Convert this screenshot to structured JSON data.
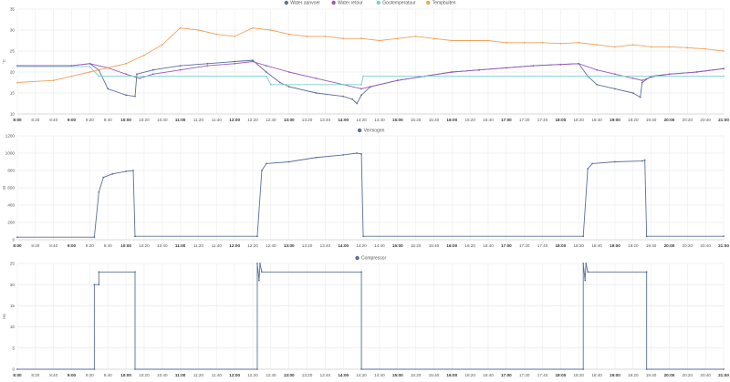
{
  "x_ticks": [
    "8:00",
    "8:20",
    "8:40",
    "9:00",
    "9:20",
    "9:40",
    "10:00",
    "10:20",
    "10:40",
    "11:00",
    "11:20",
    "11:40",
    "12:00",
    "12:20",
    "12:40",
    "13:00",
    "13:20",
    "13:40",
    "14:00",
    "14:20",
    "14:40",
    "15:00",
    "15:20",
    "15:40",
    "16:00",
    "16:20",
    "16:40",
    "17:00",
    "17:20",
    "17:40",
    "18:00",
    "18:20",
    "18:40",
    "19:00",
    "19:20",
    "19:40",
    "20:00",
    "20:20",
    "20:40",
    "21:00"
  ],
  "x_bold": [
    "8:00",
    "9:00",
    "10:00",
    "11:00",
    "12:00",
    "13:00",
    "14:00",
    "15:00",
    "16:00",
    "17:00",
    "18:00",
    "19:00",
    "20:00",
    "21:00"
  ],
  "chart_data": [
    {
      "type": "line",
      "ylabel": "°C",
      "ylim": [
        10,
        35
      ],
      "yticks": [
        10,
        15,
        20,
        25,
        30,
        35
      ],
      "grid": true,
      "legend": "top-center",
      "x_unit": "time (8:00–21:00)",
      "series": [
        {
          "name": "Water aanvoer",
          "color": "#5b6f9a",
          "marker": "filled",
          "points": [
            [
              "8:00",
              21.5
            ],
            [
              "9:00",
              21.5
            ],
            [
              "9:20",
              22.0
            ],
            [
              "9:30",
              20.5
            ],
            [
              "9:40",
              16.0
            ],
            [
              "10:00",
              14.5
            ],
            [
              "10:10",
              14.2
            ],
            [
              "10:12",
              19.5
            ],
            [
              "10:30",
              20.5
            ],
            [
              "11:00",
              21.5
            ],
            [
              "11:30",
              22.0
            ],
            [
              "12:00",
              22.5
            ],
            [
              "12:20",
              22.8
            ],
            [
              "12:35",
              20.0
            ],
            [
              "12:50",
              17.5
            ],
            [
              "13:00",
              16.5
            ],
            [
              "13:30",
              15.0
            ],
            [
              "14:00",
              14.2
            ],
            [
              "14:10",
              13.5
            ],
            [
              "14:15",
              12.5
            ],
            [
              "14:20",
              14.5
            ],
            [
              "14:30",
              16.5
            ],
            [
              "15:00",
              18.0
            ],
            [
              "15:30",
              19.0
            ],
            [
              "16:00",
              20.0
            ],
            [
              "16:30",
              20.5
            ],
            [
              "17:00",
              21.0
            ],
            [
              "17:30",
              21.5
            ],
            [
              "18:00",
              21.8
            ],
            [
              "18:20",
              22.0
            ],
            [
              "18:30",
              19.0
            ],
            [
              "18:40",
              17.0
            ],
            [
              "19:00",
              16.0
            ],
            [
              "19:20",
              15.0
            ],
            [
              "19:28",
              14.0
            ],
            [
              "19:30",
              17.5
            ],
            [
              "19:40",
              19.0
            ],
            [
              "20:00",
              19.5
            ],
            [
              "20:30",
              20.0
            ],
            [
              "21:00",
              20.8
            ]
          ]
        },
        {
          "name": "Water retour",
          "color": "#9b59b6",
          "marker": "filled",
          "points": [
            [
              "8:00",
              21.5
            ],
            [
              "9:00",
              21.5
            ],
            [
              "9:20",
              22.0
            ],
            [
              "9:40",
              21.0
            ],
            [
              "10:00",
              19.5
            ],
            [
              "10:15",
              18.5
            ],
            [
              "10:30",
              19.5
            ],
            [
              "11:00",
              20.5
            ],
            [
              "11:30",
              21.5
            ],
            [
              "12:00",
              22.0
            ],
            [
              "12:20",
              22.5
            ],
            [
              "12:35",
              21.5
            ],
            [
              "13:00",
              20.0
            ],
            [
              "13:30",
              18.5
            ],
            [
              "14:00",
              17.0
            ],
            [
              "14:20",
              16.0
            ],
            [
              "14:30",
              16.5
            ],
            [
              "15:00",
              18.0
            ],
            [
              "15:30",
              19.0
            ],
            [
              "16:00",
              20.0
            ],
            [
              "16:30",
              20.5
            ],
            [
              "17:00",
              21.0
            ],
            [
              "17:30",
              21.5
            ],
            [
              "18:00",
              21.8
            ],
            [
              "18:20",
              22.0
            ],
            [
              "18:40",
              20.5
            ],
            [
              "19:00",
              19.5
            ],
            [
              "19:20",
              18.5
            ],
            [
              "19:30",
              18.0
            ],
            [
              "19:40",
              18.8
            ],
            [
              "20:00",
              19.5
            ],
            [
              "20:30",
              20.0
            ],
            [
              "21:00",
              20.8
            ]
          ]
        },
        {
          "name": "Gootemperatuur",
          "color": "#7ecfd3",
          "marker": "filled",
          "points": [
            [
              "8:00",
              21.3
            ],
            [
              "9:20",
              21.3
            ],
            [
              "9:30",
              19.0
            ],
            [
              "12:35",
              19.0
            ],
            [
              "12:40",
              17.0
            ],
            [
              "14:00",
              17.0
            ],
            [
              "14:20",
              17.0
            ],
            [
              "14:22",
              19.0
            ],
            [
              "21:00",
              19.0
            ]
          ]
        },
        {
          "name": "Tempbuiten",
          "color": "#f0a35b",
          "marker": "filled",
          "points": [
            [
              "8:00",
              17.5
            ],
            [
              "8:40",
              18.0
            ],
            [
              "9:00",
              19.0
            ],
            [
              "9:20",
              20.0
            ],
            [
              "9:40",
              21.0
            ],
            [
              "10:00",
              22.0
            ],
            [
              "10:20",
              24.0
            ],
            [
              "10:40",
              26.5
            ],
            [
              "11:00",
              30.5
            ],
            [
              "11:20",
              30.0
            ],
            [
              "11:40",
              29.0
            ],
            [
              "12:00",
              28.5
            ],
            [
              "12:20",
              30.5
            ],
            [
              "12:40",
              30.0
            ],
            [
              "13:00",
              29.0
            ],
            [
              "13:20",
              28.5
            ],
            [
              "13:40",
              28.5
            ],
            [
              "14:00",
              28.0
            ],
            [
              "14:20",
              28.0
            ],
            [
              "14:40",
              27.5
            ],
            [
              "15:00",
              28.0
            ],
            [
              "15:20",
              28.5
            ],
            [
              "15:40",
              28.0
            ],
            [
              "16:00",
              27.5
            ],
            [
              "16:20",
              27.5
            ],
            [
              "16:40",
              27.5
            ],
            [
              "17:00",
              27.0
            ],
            [
              "17:20",
              27.0
            ],
            [
              "17:40",
              27.0
            ],
            [
              "18:00",
              26.8
            ],
            [
              "18:20",
              27.0
            ],
            [
              "18:40",
              26.5
            ],
            [
              "19:00",
              26.0
            ],
            [
              "19:20",
              26.5
            ],
            [
              "19:40",
              26.0
            ],
            [
              "20:00",
              26.0
            ],
            [
              "20:20",
              25.8
            ],
            [
              "20:40",
              25.5
            ],
            [
              "21:00",
              25.0
            ]
          ]
        }
      ]
    },
    {
      "type": "line",
      "ylabel": "W",
      "ylim": [
        0,
        1200
      ],
      "yticks": [
        0,
        200,
        400,
        600,
        800,
        1000,
        1200
      ],
      "grid": true,
      "legend": "top-center",
      "series": [
        {
          "name": "Vermogen",
          "color": "#5b6f9a",
          "marker": "filled",
          "points": [
            [
              "8:00",
              30
            ],
            [
              "9:25",
              30
            ],
            [
              "9:30",
              550
            ],
            [
              "9:35",
              720
            ],
            [
              "9:45",
              760
            ],
            [
              "10:00",
              790
            ],
            [
              "10:08",
              800
            ],
            [
              "10:10",
              40
            ],
            [
              "12:25",
              40
            ],
            [
              "12:30",
              800
            ],
            [
              "12:35",
              880
            ],
            [
              "13:00",
              900
            ],
            [
              "13:30",
              950
            ],
            [
              "14:00",
              980
            ],
            [
              "14:15",
              1000
            ],
            [
              "14:20",
              990
            ],
            [
              "14:22",
              40
            ],
            [
              "18:25",
              40
            ],
            [
              "18:30",
              820
            ],
            [
              "18:35",
              880
            ],
            [
              "19:00",
              900
            ],
            [
              "19:30",
              910
            ],
            [
              "19:33",
              920
            ],
            [
              "19:35",
              40
            ],
            [
              "21:00",
              40
            ]
          ]
        }
      ]
    },
    {
      "type": "line",
      "ylabel": "Hz",
      "ylim": [
        0,
        25
      ],
      "yticks": [
        0,
        5,
        10,
        15,
        20,
        25
      ],
      "grid": true,
      "legend": "top-center",
      "series": [
        {
          "name": "Compressor",
          "color": "#5b6f9a",
          "marker": "filled",
          "points": [
            [
              "8:00",
              0
            ],
            [
              "9:25",
              0
            ],
            [
              "9:25",
              20
            ],
            [
              "9:30",
              20
            ],
            [
              "9:30",
              23
            ],
            [
              "10:10",
              23
            ],
            [
              "10:10",
              0
            ],
            [
              "12:25",
              0
            ],
            [
              "12:25",
              25
            ],
            [
              "12:27",
              21
            ],
            [
              "12:28",
              25
            ],
            [
              "12:30",
              23
            ],
            [
              "14:20",
              23
            ],
            [
              "14:20",
              0
            ],
            [
              "18:25",
              0
            ],
            [
              "18:25",
              25
            ],
            [
              "18:27",
              21
            ],
            [
              "18:28",
              25
            ],
            [
              "18:30",
              23
            ],
            [
              "19:35",
              23
            ],
            [
              "19:35",
              0
            ],
            [
              "21:00",
              0
            ]
          ]
        }
      ]
    }
  ]
}
